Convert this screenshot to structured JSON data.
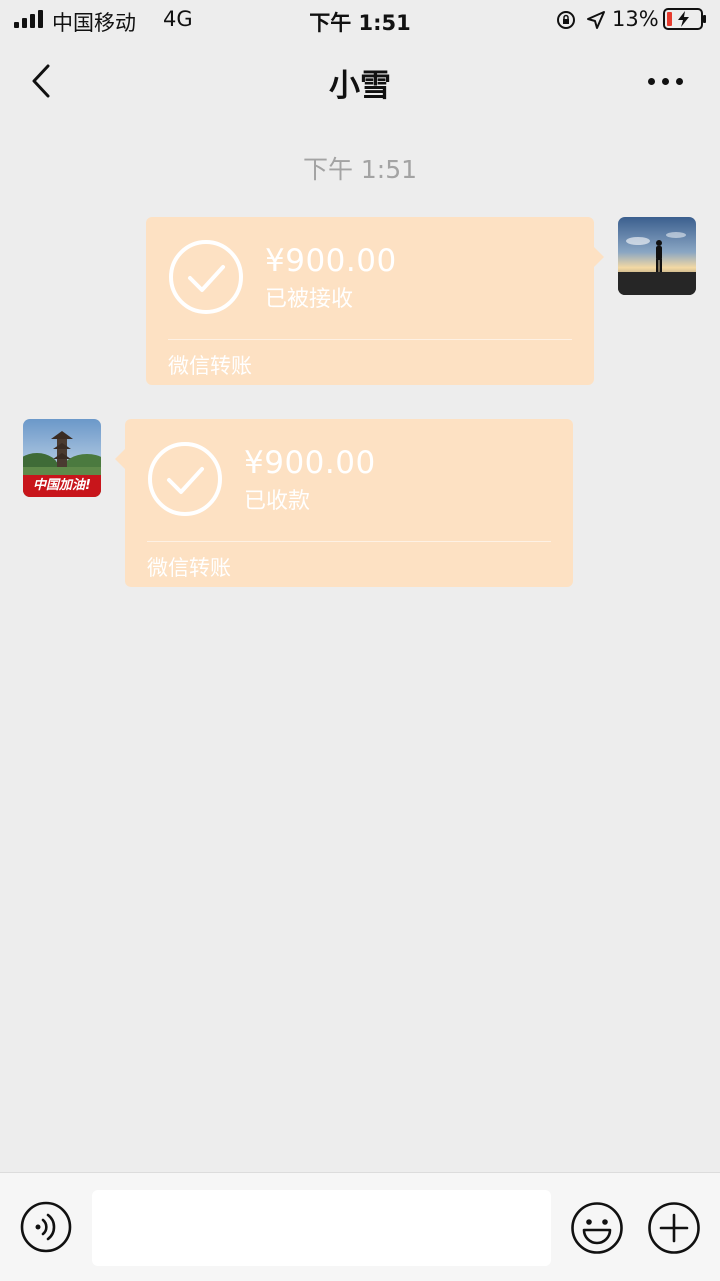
{
  "status_bar": {
    "carrier": "中国移动",
    "network": "4G",
    "time": "下午 1:51",
    "battery_percent": "13%"
  },
  "nav": {
    "title": "小雪"
  },
  "chat": {
    "timestamp": "下午 1:51",
    "messages": [
      {
        "direction": "sent",
        "amount": "¥900.00",
        "status": "已被接收",
        "footer": "微信转账"
      },
      {
        "direction": "received",
        "amount": "¥900.00",
        "status": "已收款",
        "footer": "微信转账"
      }
    ],
    "friend_avatar_badge": "中国加油!"
  },
  "input_bar": {
    "placeholder": ""
  },
  "colors": {
    "background": "#ededed",
    "transfer_bubble": "#fde1c3",
    "badge_red": "#c8151b",
    "battery_low": "#e63b2e"
  }
}
